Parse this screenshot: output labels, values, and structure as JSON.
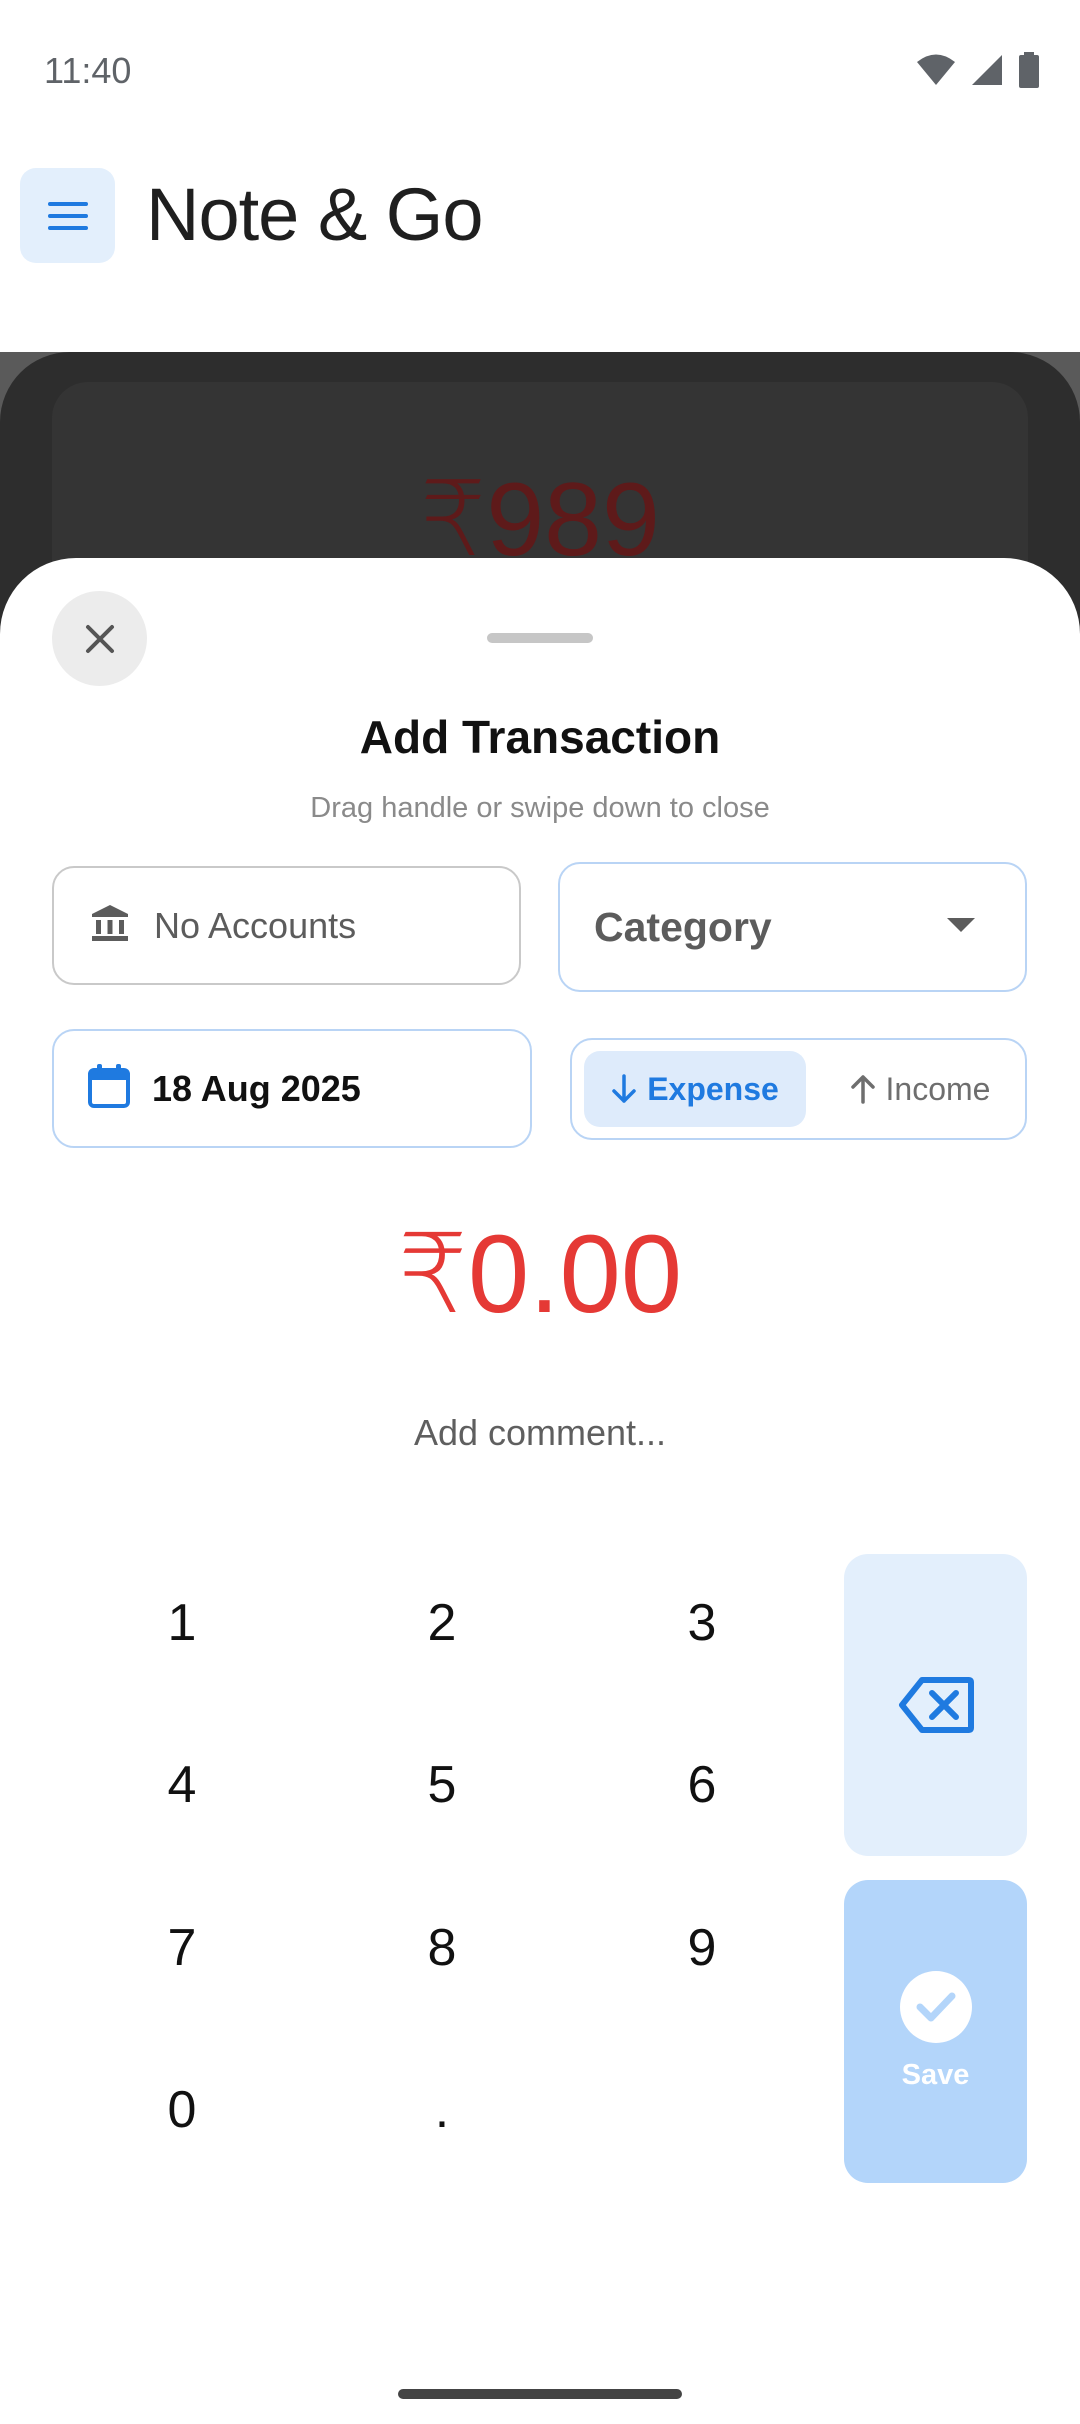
{
  "status_bar": {
    "time": "11:40",
    "icons": [
      "wifi-icon",
      "signal-icon",
      "battery-icon"
    ]
  },
  "app_bar": {
    "title": "Note & Go",
    "menu_icon": "menu-icon"
  },
  "background": {
    "amount": "₹989"
  },
  "sheet": {
    "title": "Add Transaction",
    "subtitle": "Drag handle or swipe down to close",
    "account": {
      "icon": "bank-icon",
      "label": "No Accounts"
    },
    "category": {
      "label": "Category",
      "icon": "dropdown-caret-icon"
    },
    "date": {
      "icon": "calendar-icon",
      "label": "18 Aug 2025"
    },
    "type_toggle": {
      "expense_label": "Expense",
      "income_label": "Income",
      "selected": "Expense"
    },
    "amount": "₹0.00",
    "comment_placeholder": "Add comment...",
    "keypad": {
      "keys": [
        "1",
        "2",
        "3",
        "4",
        "5",
        "6",
        "7",
        "8",
        "9",
        "0",
        "."
      ],
      "backspace_icon": "backspace-icon",
      "save_label": "Save"
    }
  },
  "colors": {
    "accent": "#1f7ae0",
    "amount_negative": "#e53935",
    "save_button": "#b3d5fa",
    "backspace_button": "#e3effc"
  }
}
